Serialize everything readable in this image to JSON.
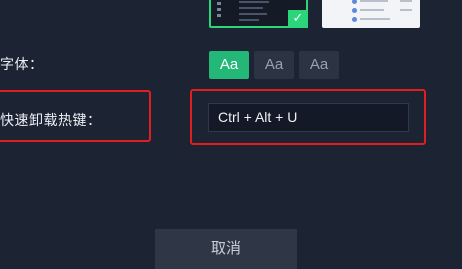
{
  "theme": {
    "options": [
      "dark",
      "light"
    ],
    "selected": "dark",
    "check_glyph": "✓"
  },
  "font": {
    "label": "字体：",
    "options": [
      "Aa",
      "Aa",
      "Aa"
    ],
    "selected_index": 0
  },
  "hotkey": {
    "label": "快速卸载热键：",
    "value": "Ctrl + Alt + U"
  },
  "footer": {
    "cancel_label": "取消"
  },
  "colors": {
    "accent": "#23b877",
    "highlight": "#e01e1e",
    "background": "#1c2333"
  }
}
